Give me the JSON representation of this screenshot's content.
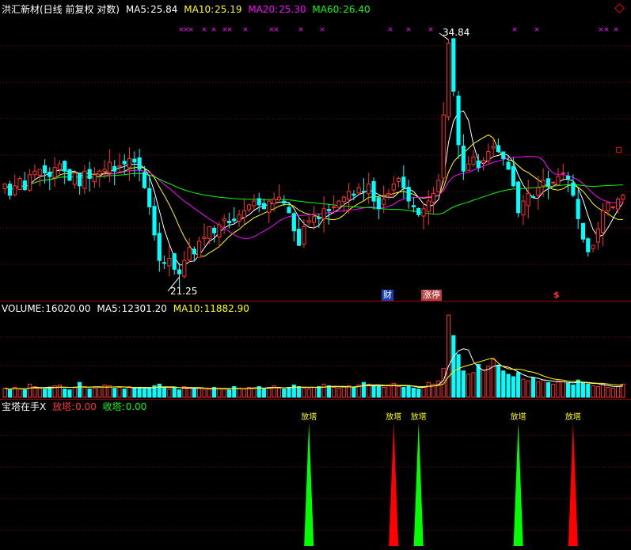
{
  "price_header": {
    "name": "洪汇新材(日线 前复权 对数)",
    "ma5_label": "MA5:",
    "ma5_value": "25.84",
    "ma10_label": "MA10:",
    "ma10_value": "25.19",
    "ma20_label": "MA20:",
    "ma20_value": "25.30",
    "ma60_label": "MA60:",
    "ma60_value": "26.40"
  },
  "volume_header": {
    "title": "VOLUME:",
    "volume_value": "16020.00",
    "ma5_label": "MA5:",
    "ma5_value": "12301.20",
    "ma10_label": "MA10:",
    "ma10_value": "11882.90"
  },
  "indicator_header": {
    "name": "宝塔在手X",
    "fang_label": "放塔:",
    "fang_value": "0.00",
    "shou_label": "收塔:",
    "shou_value": "0.00"
  },
  "annotations": {
    "high_price": "34.84",
    "low_price": "21.25",
    "tag_cai": "财",
    "tag_zhangting": "涨停",
    "tag_dollar": "$"
  },
  "colors": {
    "background": "#000000",
    "up": "#ff3232",
    "down": "#00ffff",
    "ma5": "#ffffff",
    "ma10": "#ffff00",
    "ma20": "#ff00ff",
    "ma60": "#00ff00",
    "separator": "#aa0000",
    "spike_green": "#00ff00",
    "spike_red": "#ff0000"
  },
  "chart_data": [
    {
      "type": "candlestick",
      "title": "洪汇新材(日线 前复权 对数)",
      "scale": "log",
      "ylim": [
        20.5,
        36.5
      ],
      "grid": true,
      "high_marker": 34.84,
      "low_marker": 21.25,
      "closes": [
        25.8,
        25.2,
        25.7,
        26.1,
        25.5,
        26.3,
        26.5,
        26.6,
        26.4,
        26.2,
        26.7,
        26.9,
        26.5,
        26.0,
        26.4,
        25.7,
        26.5,
        26.1,
        26.3,
        26.5,
        26.6,
        27.0,
        26.5,
        26.8,
        26.9,
        27.2,
        27.0,
        26.6,
        25.6,
        24.6,
        23.2,
        22.0,
        21.9,
        22.1,
        21.6,
        21.4,
        22.0,
        22.6,
        22.3,
        22.9,
        23.1,
        23.6,
        23.3,
        23.7,
        24.0,
        23.8,
        23.9,
        24.2,
        24.4,
        24.7,
        24.9,
        24.7,
        24.5,
        24.9,
        25.0,
        25.1,
        24.8,
        24.3,
        23.4,
        22.7,
        23.6,
        23.9,
        24.1,
        24.0,
        24.5,
        24.4,
        24.6,
        24.9,
        25.1,
        25.4,
        25.2,
        25.6,
        25.4,
        25.8,
        24.9,
        24.5,
        25.0,
        25.3,
        25.8,
        26.1,
        25.6,
        24.9,
        24.6,
        24.2,
        24.5,
        24.9,
        25.3,
        26.0,
        29.8,
        34.6,
        31.3,
        28.0,
        26.5,
        26.9,
        27.3,
        26.7,
        27.1,
        27.6,
        27.9,
        27.6,
        27.2,
        26.6,
        25.7,
        24.3,
        24.9,
        25.3,
        25.1,
        25.6,
        26.0,
        25.7,
        25.9,
        26.2,
        26.4,
        26.1,
        25.2,
        24.0,
        23.0,
        22.4,
        22.7,
        23.5,
        24.4,
        24.8,
        24.6,
        25.0,
        25.2
      ],
      "volumes": [
        1.1,
        0.9,
        1.2,
        1.0,
        0.9,
        1.6,
        1.3,
        1.1,
        1.0,
        1.2,
        1.4,
        1.5,
        1.0,
        0.9,
        1.2,
        1.8,
        1.3,
        1.0,
        1.1,
        1.2,
        1.5,
        1.4,
        1.1,
        1.2,
        1.0,
        1.3,
        1.1,
        1.2,
        1.0,
        1.1,
        1.4,
        1.6,
        1.2,
        1.0,
        1.1,
        0.9,
        1.3,
        1.2,
        1.0,
        1.1,
        0.9,
        1.0,
        1.2,
        1.1,
        1.0,
        0.9,
        1.3,
        1.1,
        1.0,
        1.2,
        1.1,
        1.3,
        1.0,
        1.2,
        1.4,
        1.1,
        1.0,
        1.2,
        1.5,
        1.3,
        1.1,
        1.0,
        1.2,
        1.3,
        1.6,
        1.4,
        1.2,
        1.1,
        1.3,
        1.4,
        1.2,
        1.5,
        1.8,
        1.6,
        1.4,
        1.3,
        1.2,
        1.5,
        1.7,
        1.3,
        1.2,
        1.4,
        1.1,
        1.0,
        1.3,
        1.8,
        1.6,
        2.0,
        3.5,
        10.0,
        7.5,
        5.2,
        3.2,
        2.8,
        3.0,
        4.0,
        3.3,
        3.8,
        4.6,
        3.9,
        3.2,
        2.8,
        2.5,
        3.0,
        2.2,
        2.0,
        2.4,
        1.9,
        2.1,
        1.8,
        1.6,
        2.0,
        1.9,
        1.7,
        1.5,
        2.1,
        1.8,
        1.6,
        1.4,
        1.3,
        1.6,
        1.2,
        1.1,
        1.3,
        1.6
      ]
    },
    {
      "type": "bar",
      "title": "宝塔在手X",
      "series": [
        {
          "name": "收塔",
          "color": "#00ff00",
          "x_index": [
            61,
            83,
            103
          ]
        },
        {
          "name": "放塔",
          "color": "#ff0000",
          "x_index": [
            78,
            114
          ]
        }
      ],
      "spike_label": "放塔"
    }
  ]
}
